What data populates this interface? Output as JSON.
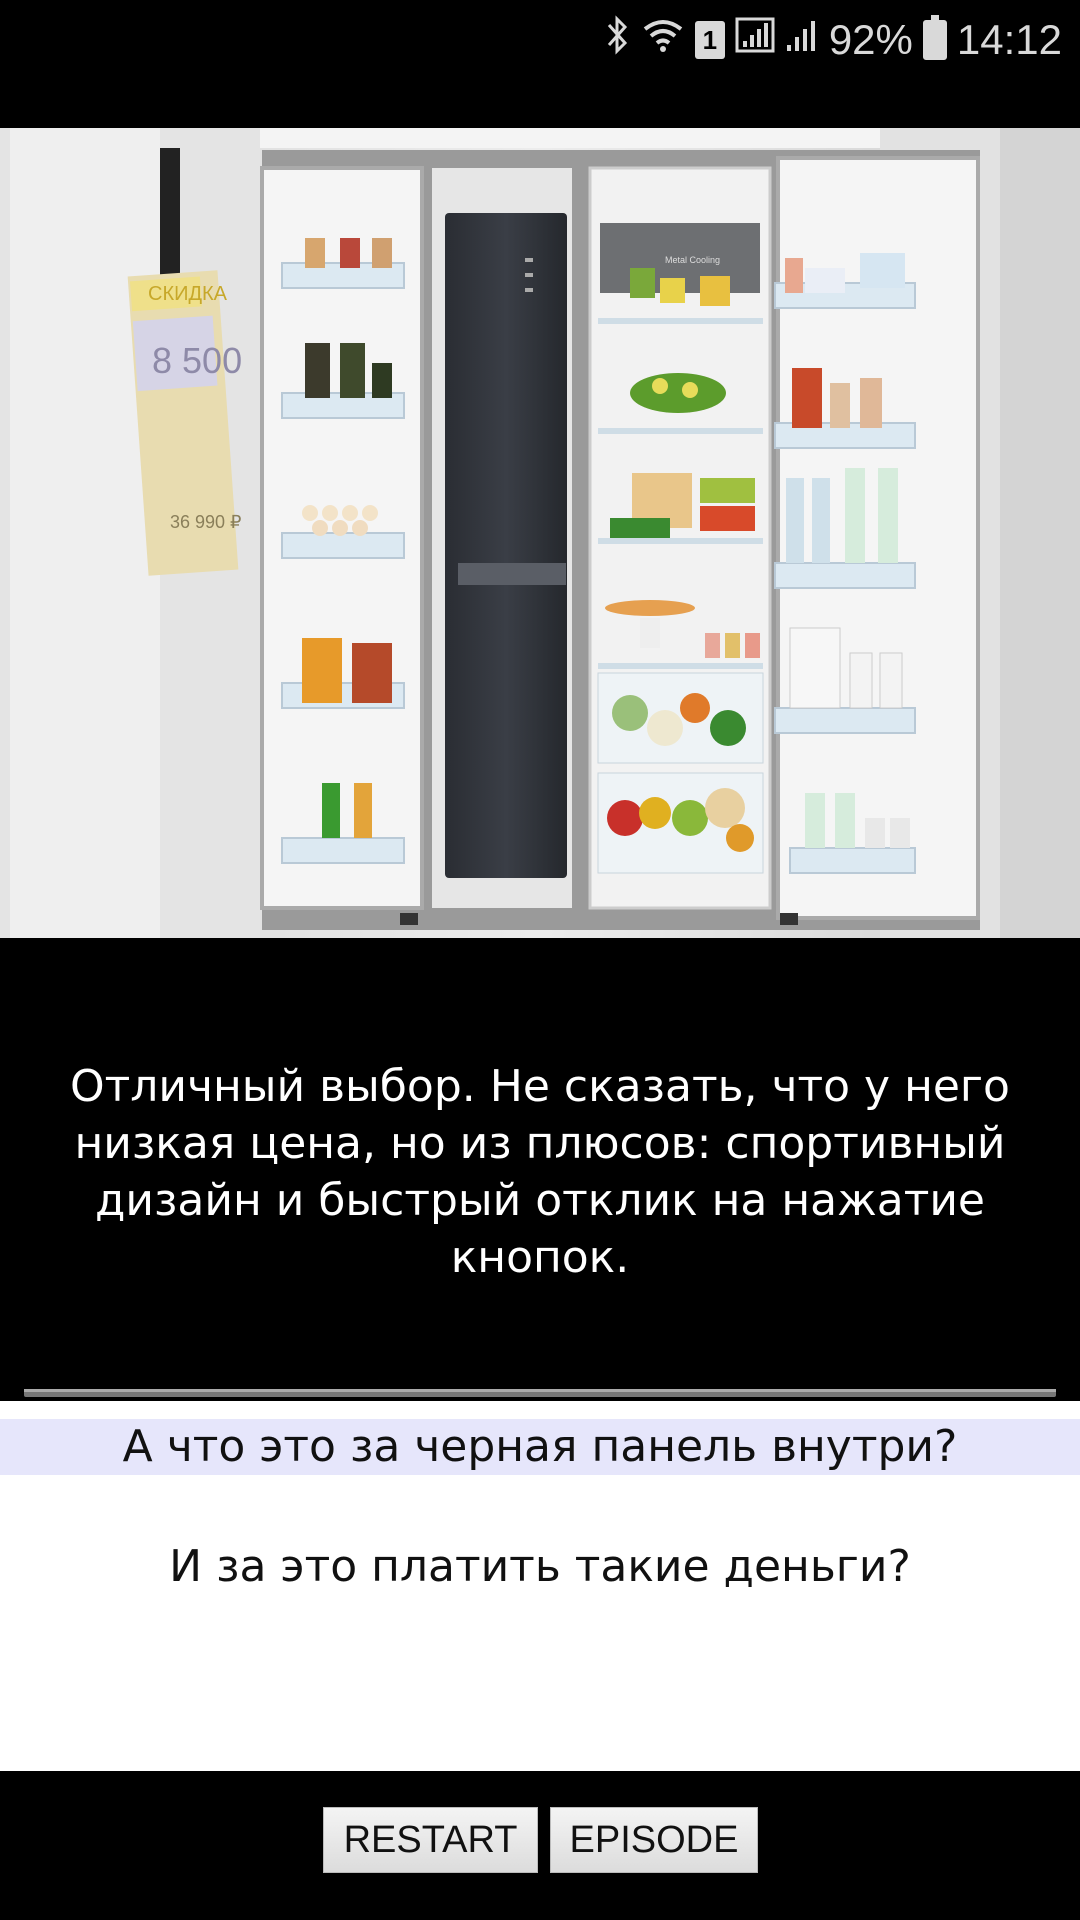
{
  "status_bar": {
    "battery_percent": "92%",
    "time": "14:12",
    "sim_number": "1",
    "icons": [
      "bluetooth-icon",
      "wifi-icon",
      "sim-icon",
      "signal-icon",
      "signal-icon",
      "battery-icon"
    ]
  },
  "scene": {
    "price_tag_label": "СКИДКА",
    "price_tag_value": "8 500",
    "price_tag_small": "36 990 ₽",
    "shelf_label": "Metal Cooling"
  },
  "dialog": {
    "text": "Отличный выбор. Не сказать, что у него низкая цена, но из плюсов: спортивный дизайн и быстрый отклик на нажатие кнопок."
  },
  "choices": [
    {
      "label": "А что это за черная панель внутри?"
    },
    {
      "label": "И за это платить такие деньги?"
    }
  ],
  "buttons": {
    "restart": "RESTART",
    "episode": "EPISODE"
  },
  "colors": {
    "background": "#000000",
    "choice_highlight": "#e6e6fb",
    "choice_bg": "#ffffff"
  }
}
